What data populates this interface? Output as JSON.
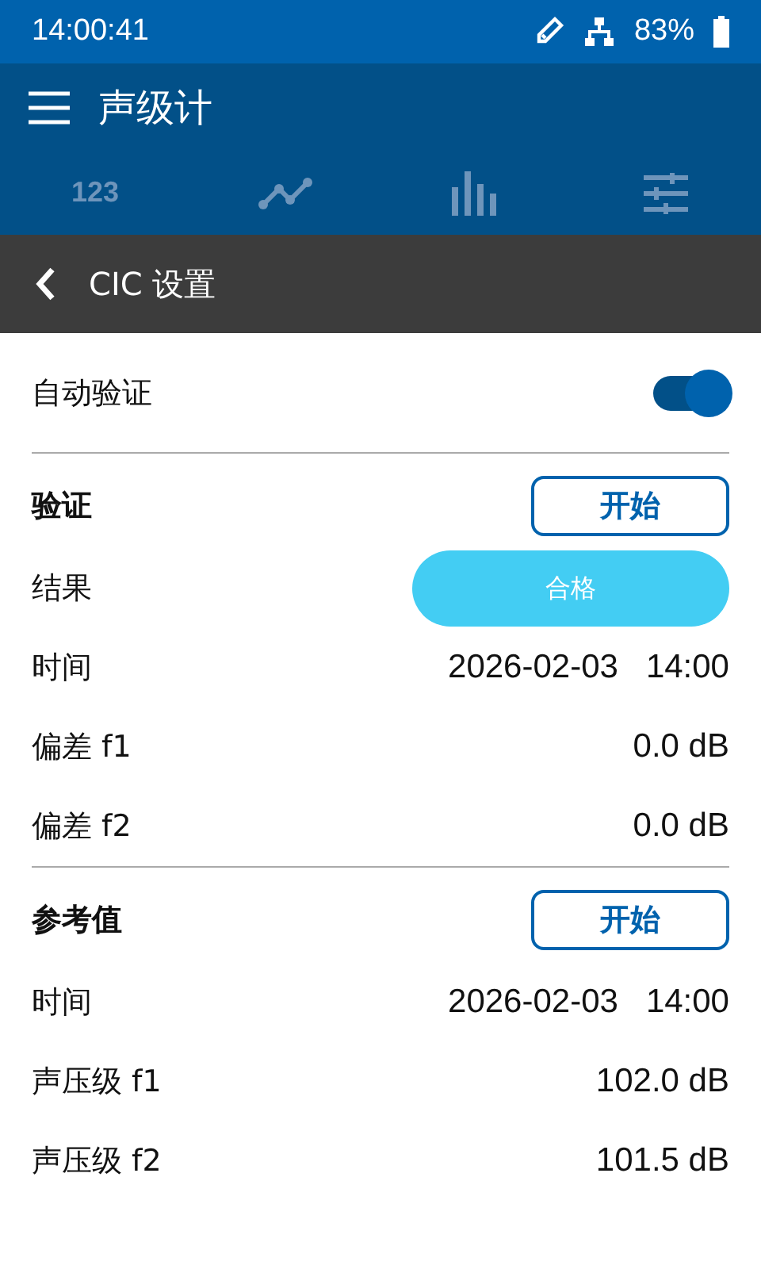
{
  "status_bar": {
    "time": "14:00:41",
    "battery": "83%"
  },
  "app_bar": {
    "title": "声级计"
  },
  "tabs": [
    {
      "kind": "text",
      "label": "123",
      "selected": false
    },
    {
      "kind": "line",
      "selected": false
    },
    {
      "kind": "bars",
      "selected": false
    },
    {
      "kind": "sliders",
      "selected": false
    }
  ],
  "sub_header": {
    "title": "CIC 设置"
  },
  "auto_verify": {
    "label": "自动验证",
    "on": true
  },
  "sections": [
    {
      "title": "验证",
      "button": "开始",
      "rows": [
        {
          "kind": "result",
          "label": "结果",
          "value": "合格"
        },
        {
          "kind": "datetime",
          "label": "时间",
          "date": "2026-02-03",
          "time": "14:00"
        },
        {
          "kind": "value",
          "label": "偏差 f1",
          "value": "0.0 dB"
        },
        {
          "kind": "value",
          "label": "偏差 f2",
          "value": "0.0 dB"
        }
      ]
    },
    {
      "title": "参考值",
      "button": "开始",
      "rows": [
        {
          "kind": "datetime",
          "label": "时间",
          "date": "2026-02-03",
          "time": "14:00"
        },
        {
          "kind": "value",
          "label": "声压级 f1",
          "value": "102.0 dB"
        },
        {
          "kind": "value",
          "label": "声压级 f2",
          "value": "101.5 dB"
        }
      ]
    }
  ]
}
